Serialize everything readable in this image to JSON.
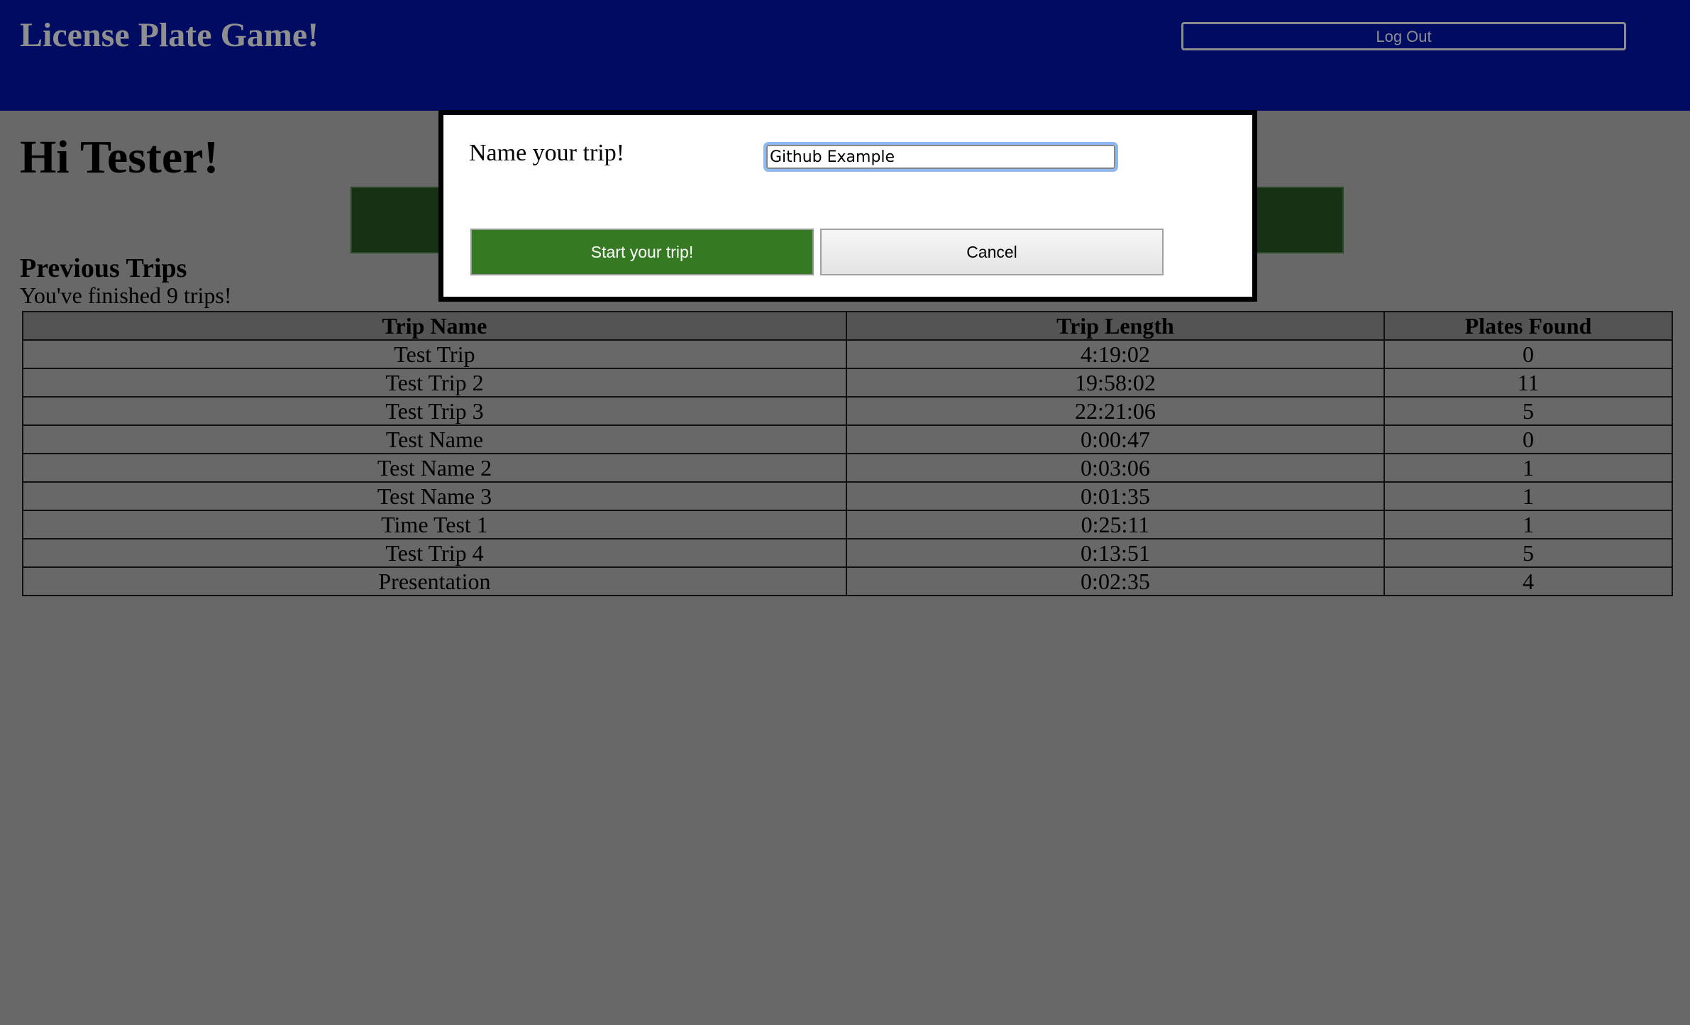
{
  "header": {
    "title": "License Plate Game!",
    "logout_label": "Log Out"
  },
  "main": {
    "greeting": "Hi Tester!",
    "previous_trips_title": "Previous Trips",
    "trip_count_text": "You've finished 9 trips!"
  },
  "table": {
    "headers": [
      "Trip Name",
      "Trip Length",
      "Plates Found"
    ],
    "rows": [
      [
        "Test Trip",
        "4:19:02",
        "0"
      ],
      [
        "Test Trip 2",
        "19:58:02",
        "11"
      ],
      [
        "Test Trip 3",
        "22:21:06",
        "5"
      ],
      [
        "Test Name",
        "0:00:47",
        "0"
      ],
      [
        "Test Name 2",
        "0:03:06",
        "1"
      ],
      [
        "Test Name 3",
        "0:01:35",
        "1"
      ],
      [
        "Time Test 1",
        "0:25:11",
        "1"
      ],
      [
        "Test Trip 4",
        "0:13:51",
        "5"
      ],
      [
        "Presentation",
        "0:02:35",
        "4"
      ]
    ]
  },
  "modal": {
    "label": "Name your trip!",
    "input_value": "Github Example",
    "start_label": "Start your trip!",
    "cancel_label": "Cancel"
  },
  "colors": {
    "header_bg": "#000c62",
    "overlay_bg": "#686868",
    "start_green": "#357a22",
    "focus_ring": "#8db8f0"
  }
}
